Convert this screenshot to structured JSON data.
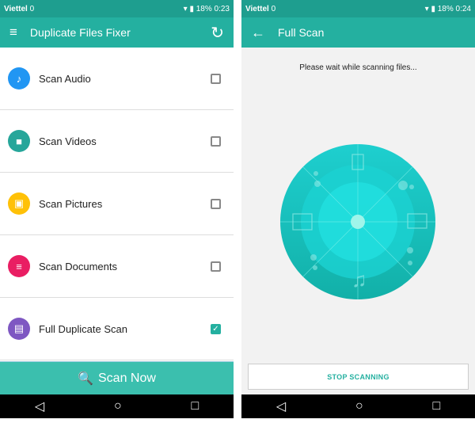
{
  "left": {
    "status": {
      "carrier": "Viettel",
      "data_rate": "0",
      "battery": "18%",
      "time": "0:23"
    },
    "toolbar": {
      "title": "Duplicate Files Fixer"
    },
    "items": [
      {
        "label": "Scan Audio",
        "icon": "music-note-icon",
        "color": "#2196f3",
        "checked": false
      },
      {
        "label": "Scan Videos",
        "icon": "video-camera-icon",
        "color": "#26a69a",
        "checked": false
      },
      {
        "label": "Scan Pictures",
        "icon": "image-icon",
        "color": "#ffc107",
        "checked": false
      },
      {
        "label": "Scan Documents",
        "icon": "document-icon",
        "color": "#e91e63",
        "checked": false
      },
      {
        "label": "Full Duplicate Scan",
        "icon": "file-icon",
        "color": "#7e57c2",
        "checked": true
      }
    ],
    "scan_button": "Scan Now"
  },
  "right": {
    "status": {
      "carrier": "Viettel",
      "data_rate": "0",
      "battery": "18%",
      "time": "0:24"
    },
    "toolbar": {
      "title": "Full Scan"
    },
    "message": "Please wait while scanning files...",
    "stop_button": "STOP SCANNING"
  },
  "colors": {
    "accent": "#24b0a0",
    "status_bar": "#1e9e8f"
  }
}
